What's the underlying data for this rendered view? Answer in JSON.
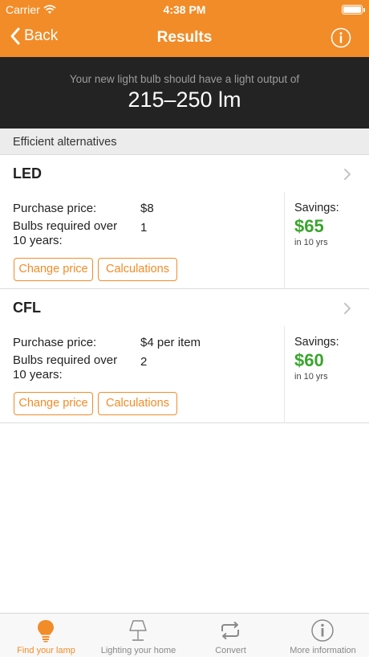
{
  "status_bar": {
    "carrier": "Carrier",
    "time": "4:38 PM"
  },
  "nav": {
    "back_label": "Back",
    "title": "Results"
  },
  "banner": {
    "subtitle": "Your new light bulb should have a light output of",
    "output": "215–250 lm"
  },
  "section": {
    "title": "Efficient alternatives"
  },
  "alternatives": [
    {
      "type": "LED",
      "purchase_label": "Purchase price:",
      "purchase_value": "$8",
      "bulbs_label_1": "Bulbs required over",
      "bulbs_label_2": "10 years:",
      "bulbs_value": "1",
      "savings_label": "Savings:",
      "savings_value": "$65",
      "savings_period": "in 10 yrs",
      "change_price_label": "Change price",
      "calculations_label": "Calculations"
    },
    {
      "type": "CFL",
      "purchase_label": "Purchase price:",
      "purchase_value": "$4 per item",
      "bulbs_label_1": "Bulbs required over",
      "bulbs_label_2": "10 years:",
      "bulbs_value": "2",
      "savings_label": "Savings:",
      "savings_value": "$60",
      "savings_period": "in 10 yrs",
      "change_price_label": "Change price",
      "calculations_label": "Calculations"
    }
  ],
  "tabs": [
    {
      "label": "Find your lamp",
      "icon": "bulb-icon",
      "active": true
    },
    {
      "label": "Lighting your home",
      "icon": "lamp-icon",
      "active": false
    },
    {
      "label": "Convert",
      "icon": "repeat-icon",
      "active": false
    },
    {
      "label": "More information",
      "icon": "info-icon",
      "active": false
    }
  ],
  "colors": {
    "accent": "#f28c28",
    "banner": "#232323",
    "savings": "#3aa52e",
    "tab_inactive": "#888888"
  }
}
